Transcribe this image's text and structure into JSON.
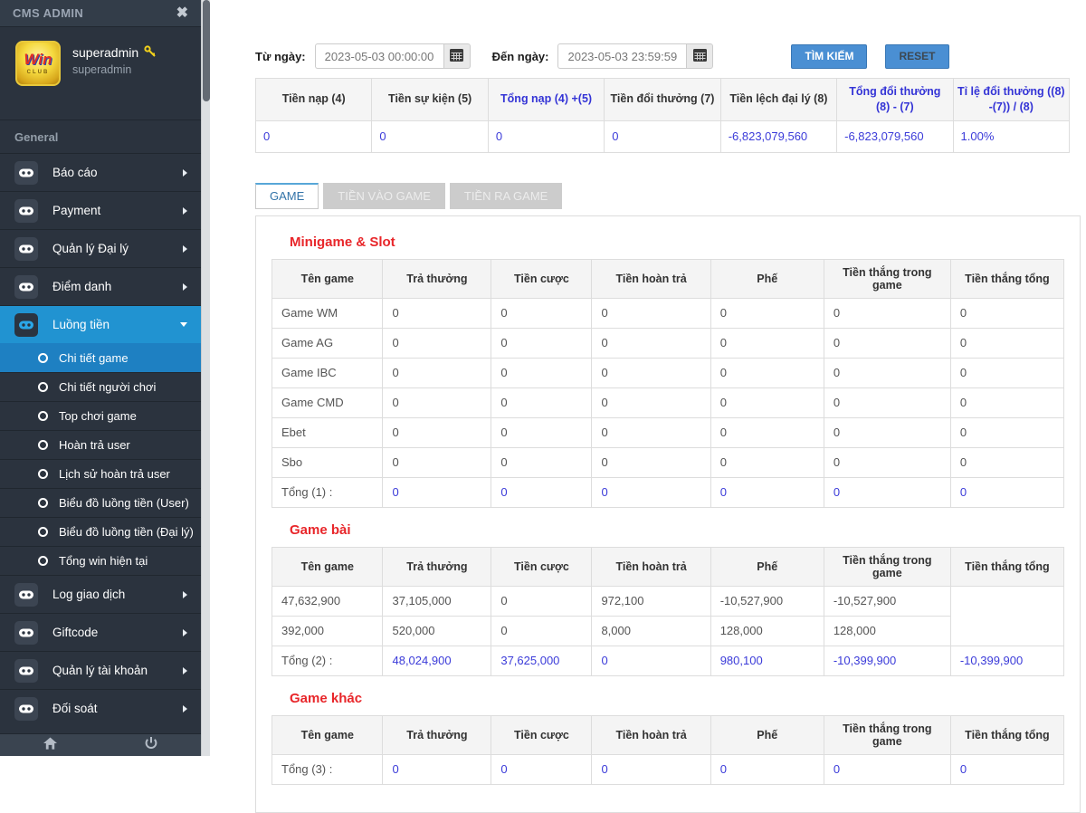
{
  "colors": {
    "sidebar_bg": "#2b333e",
    "accent_blue": "#2193d1",
    "submenu_active_blue": "#1e80c2",
    "link_blue": "#3b3bd9",
    "section_red": "#e8262a",
    "button_blue": "#4a8fd3"
  },
  "sidebar": {
    "title": "CMS ADMIN",
    "close_icon": "✖",
    "user": {
      "name": "superadmin",
      "subtitle": "superadmin",
      "avatar_text": "Win",
      "avatar_subtext": "CLUB"
    },
    "section_label": "General",
    "menu_top": [
      {
        "label": "Báo cáo"
      },
      {
        "label": "Payment"
      },
      {
        "label": "Quản lý Đại lý"
      },
      {
        "label": "Điểm danh"
      }
    ],
    "menu_expanded": {
      "label": "Luồng tiền"
    },
    "submenu": [
      {
        "label": "Chi tiết game",
        "active": true
      },
      {
        "label": "Chi tiết người chơi",
        "active": false
      },
      {
        "label": "Top chơi game",
        "active": false
      },
      {
        "label": "Hoàn trả user",
        "active": false
      },
      {
        "label": "Lịch sử hoàn trả user",
        "active": false
      },
      {
        "label": "Biểu đồ luồng tiền (User)",
        "active": false
      },
      {
        "label": "Biểu đồ luồng tiền (Đại lý)",
        "active": false
      },
      {
        "label": "Tổng win hiện tại",
        "active": false
      }
    ],
    "menu_bottom": [
      {
        "label": "Log giao dịch"
      },
      {
        "label": "Giftcode"
      },
      {
        "label": "Quản lý tài khoản"
      },
      {
        "label": "Đối soát"
      }
    ]
  },
  "filters": {
    "from_label": "Từ ngày:",
    "from_value": "2023-05-03 00:00:00",
    "to_label": "Đến ngày:",
    "to_value": "2023-05-03 23:59:59",
    "search_button": "TÌM KIẾM",
    "reset_button": "RESET"
  },
  "summary_table": {
    "headers": [
      {
        "text": "Tiền nạp (4)",
        "blue": false
      },
      {
        "text": "Tiền sự kiện (5)",
        "blue": false
      },
      {
        "text": "Tổng nạp (4) +(5)",
        "blue": true
      },
      {
        "text": "Tiền đổi thưởng (7)",
        "blue": false
      },
      {
        "text": "Tiền lệch đại lý (8)",
        "blue": false
      },
      {
        "text": "Tổng đổi thưởng (8) - (7)",
        "blue": true
      },
      {
        "text": "Tỉ lệ đổi thưởng ((8) -(7)) / (8)",
        "blue": true
      }
    ],
    "values": [
      "0",
      "0",
      "0",
      "0",
      "-6,823,079,560",
      "-6,823,079,560",
      "1.00%"
    ]
  },
  "tabs": [
    {
      "label": "GAME",
      "active": true
    },
    {
      "label": "TIỀN VÀO GAME",
      "active": false
    },
    {
      "label": "TIỀN RA GAME",
      "active": false
    }
  ],
  "game_sections": [
    {
      "title": "Minigame & Slot",
      "headers": [
        "Tên game",
        "Trả thưởng",
        "Tiền cược",
        "Tiền hoàn trả",
        "Phế",
        "Tiền thắng trong game",
        "Tiền thắng tổng"
      ],
      "rows": [
        [
          "Game WM",
          "0",
          "0",
          "0",
          "0",
          "0",
          "0"
        ],
        [
          "Game AG",
          "0",
          "0",
          "0",
          "0",
          "0",
          "0"
        ],
        [
          "Game IBC",
          "0",
          "0",
          "0",
          "0",
          "0",
          "0"
        ],
        [
          "Game CMD",
          "0",
          "0",
          "0",
          "0",
          "0",
          "0"
        ],
        [
          "Ebet",
          "0",
          "0",
          "0",
          "0",
          "0",
          "0"
        ],
        [
          "Sbo",
          "0",
          "0",
          "0",
          "0",
          "0",
          "0"
        ]
      ],
      "merged_last_column": false,
      "total": {
        "label": "Tổng (1) :",
        "values": [
          "0",
          "0",
          "0",
          "0",
          "0",
          "0"
        ]
      }
    },
    {
      "title": "Game bài",
      "headers": [
        "Tên game",
        "Trả thưởng",
        "Tiền cược",
        "Tiền hoàn trả",
        "Phế",
        "Tiền thắng trong game",
        "Tiền thắng tổng"
      ],
      "rows": [
        [
          "47,632,900",
          "37,105,000",
          "0",
          "972,100",
          "-10,527,900",
          "-10,527,900"
        ],
        [
          "392,000",
          "520,000",
          "0",
          "8,000",
          "128,000",
          "128,000"
        ]
      ],
      "merged_last_column": true,
      "total": {
        "label": "Tổng (2) :",
        "values": [
          "48,024,900",
          "37,625,000",
          "0",
          "980,100",
          "-10,399,900",
          "-10,399,900"
        ]
      }
    },
    {
      "title": "Game khác",
      "headers": [
        "Tên game",
        "Trả thưởng",
        "Tiền cược",
        "Tiền hoàn trả",
        "Phế",
        "Tiền thắng trong game",
        "Tiền thắng tổng"
      ],
      "rows": [],
      "merged_last_column": false,
      "total": {
        "label": "Tổng (3) :",
        "values": [
          "0",
          "0",
          "0",
          "0",
          "0",
          "0"
        ]
      }
    }
  ]
}
